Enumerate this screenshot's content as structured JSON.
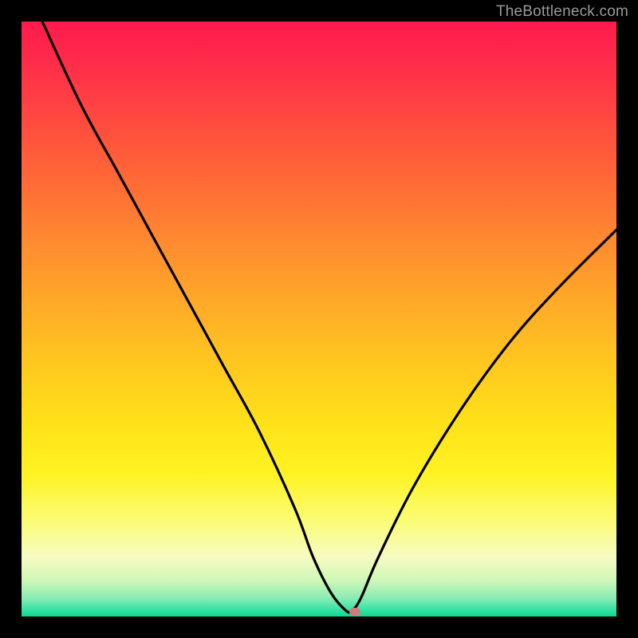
{
  "credit": "TheBottleneck.com",
  "marker_color": "#d47a7a",
  "curve_color": "#000000",
  "chart_data": {
    "type": "line",
    "title": "",
    "xlabel": "",
    "ylabel": "",
    "xlim": [
      0,
      100
    ],
    "ylim": [
      0,
      100
    ],
    "series": [
      {
        "name": "curve",
        "x": [
          3.5,
          10,
          16,
          22,
          28,
          34,
          40,
          46,
          49,
          52,
          54.5,
          55.5,
          57,
          60,
          66,
          74,
          82,
          90,
          100
        ],
        "values": [
          100,
          86,
          75,
          64,
          53,
          42,
          31,
          18,
          10,
          4,
          1,
          1,
          3,
          10,
          22,
          35,
          46,
          55,
          65
        ]
      }
    ],
    "marker": {
      "x": 56,
      "y": 0.8
    },
    "gradient_stops": [
      {
        "pos": 0,
        "color": "#ff1a4d"
      },
      {
        "pos": 50,
        "color": "#ffc61f"
      },
      {
        "pos": 88,
        "color": "#f6fbc2"
      },
      {
        "pos": 100,
        "color": "#0ed98f"
      }
    ]
  }
}
